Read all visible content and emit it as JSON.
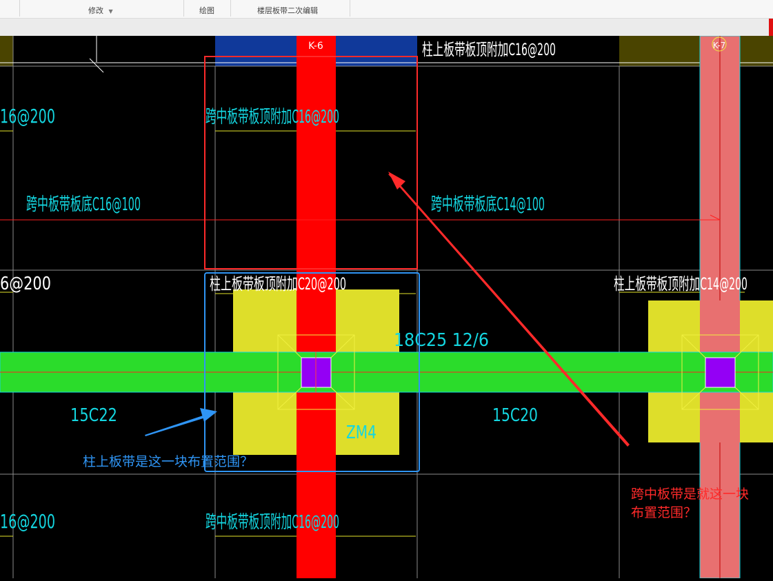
{
  "ribbon": {
    "modify_label": "修改",
    "draw_label": "绘图",
    "floor_strip_label": "楼层板带二次编辑"
  },
  "icons": {
    "modify_dropdown": "caret-down-icon"
  },
  "colors": {
    "column_strip": "#ff0000",
    "column_strip_light": "#e87070",
    "beam": "#2bdc2b",
    "column_cap": "#dede2a",
    "column": "#9400f5",
    "rebar_text": "#14d6e0",
    "annotation_red": "#ff2a2a",
    "annotation_blue": "#2f95f5"
  },
  "drawing": {
    "axis_k6": "K-6",
    "axis_k7": "K-7",
    "labels": {
      "top_column_strip_top_add": "柱上板带板顶附加C16@200",
      "left_top_partial": "16@200",
      "mid_strip_top_add_upper": "跨中板带板顶附加C16@200",
      "mid_strip_bottom_left": "跨中板带板底C16@100",
      "mid_strip_bottom_right": "跨中板带板底C14@100",
      "left_mid_partial": "6@200",
      "column_strip_top_add_center": "柱上板带板顶附加C20@200",
      "column_strip_top_add_right": "柱上板带板顶附加C14@200",
      "beam_rebar": "18C25 12/6",
      "beam_left_bottom": "15C22",
      "beam_right_bottom": "15C20",
      "cap_name": "ZM4",
      "left_bottom_partial": "16@200",
      "mid_strip_top_add_lower": "跨中板带板顶附加C16@200"
    },
    "annotations": {
      "blue_question": "柱上板带是这一块布置范围？",
      "red_question_line1": "跨中板带是就这一块",
      "red_question_line2": "布置范围？"
    }
  }
}
